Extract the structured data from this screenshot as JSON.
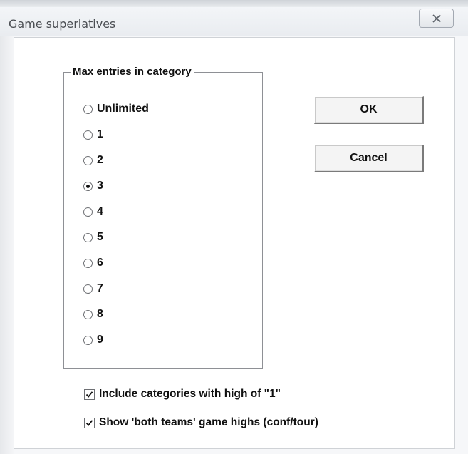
{
  "window": {
    "title": "Game superlatives",
    "close_icon": "close-icon"
  },
  "group": {
    "label": "Max entries in category",
    "options": [
      {
        "label": "Unlimited",
        "checked": false
      },
      {
        "label": "1",
        "checked": false
      },
      {
        "label": "2",
        "checked": false
      },
      {
        "label": "3",
        "checked": true
      },
      {
        "label": "4",
        "checked": false
      },
      {
        "label": "5",
        "checked": false
      },
      {
        "label": "6",
        "checked": false
      },
      {
        "label": "7",
        "checked": false
      },
      {
        "label": "8",
        "checked": false
      },
      {
        "label": "9",
        "checked": false
      }
    ],
    "selected": "3"
  },
  "buttons": {
    "ok_label": "OK",
    "cancel_label": "Cancel"
  },
  "checkboxes": [
    {
      "label": "Include categories with high of \"1\"",
      "checked": true
    },
    {
      "label": "Show 'both teams' game highs (conf/tour)",
      "checked": true
    }
  ]
}
